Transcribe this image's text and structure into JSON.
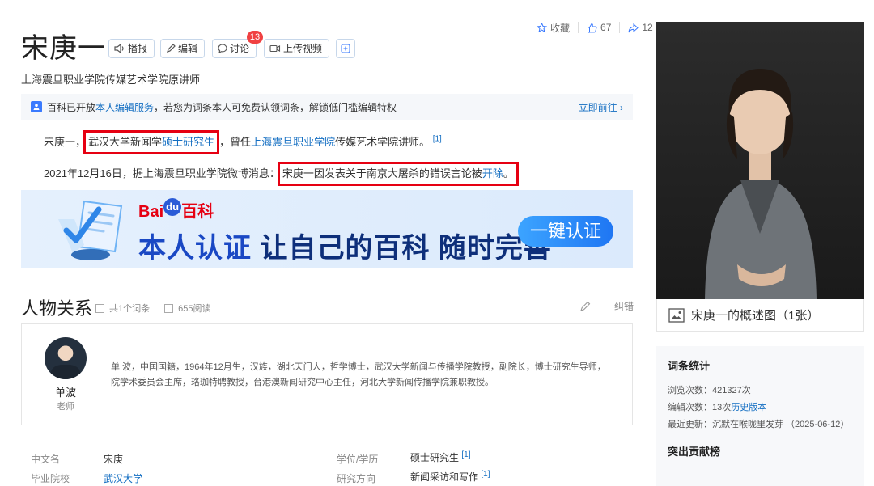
{
  "header": {
    "title": "宋庚一",
    "buttons": {
      "play": "播报",
      "edit": "编辑",
      "discuss": "讨论",
      "upload": "上传视频"
    },
    "discuss_badge": "13",
    "subtitle": "上海震旦职业学院传媒艺术学院原讲师",
    "favorite": "收藏",
    "likes": "67",
    "shares": "12"
  },
  "notice": {
    "text_a": "百科已开放",
    "link": "本人编辑服务",
    "text_b": "，若您为词条本人可免费认领词条，解锁低门槛编辑特权",
    "go": "立即前往"
  },
  "summary": {
    "p1_a": "宋庚一，",
    "p1_b": "武汉大学新闻学",
    "p1_link1": "硕士研究生",
    "p1_c": "，曾任",
    "p1_link2": "上海震旦职业学院",
    "p1_d": "传媒艺术学院讲师。",
    "p1_ref": "[1]",
    "p2_a": "2021年12月16日，据上海震旦职业学院微博消息：",
    "p2_b": "宋庚一因发表关于南京大屠杀的错误言论被",
    "p2_link": "开除",
    "p2_c": "。"
  },
  "banner": {
    "logo_a": "Bai",
    "logo_du": "du",
    "logo_b": "百科",
    "main_a": "本人认证 ",
    "main_b": "让自己的百科 随时完善",
    "button": "一键认证"
  },
  "relations": {
    "title": "人物关系",
    "entries": "共1个词条",
    "reads": "655阅读",
    "correct": "纠错",
    "person": {
      "name": "单波",
      "role": "老师",
      "desc": "单 波，中国国籍，1964年12月生，汉族，湖北天门人，哲学博士，武汉大学新闻与传播学院教授，副院长，博士研究生导师，院学术委员会主席，珞珈特聘教授，台港澳新闻研究中心主任，河北大学新闻传播学院兼职教授。"
    }
  },
  "basic_info": [
    {
      "key": "中文名",
      "value": "宋庚一",
      "link": false,
      "ref": ""
    },
    {
      "key": "学位/学历",
      "value": "硕士研究生",
      "link": false,
      "ref": "[1]"
    },
    {
      "key": "毕业院校",
      "value": "武汉大学",
      "link": true,
      "ref": ""
    },
    {
      "key": "研究方向",
      "value": "新闻采访和写作",
      "link": false,
      "ref": "[1]"
    }
  ],
  "sidebar": {
    "photo_caption": "宋庚一的概述图（1张）",
    "stats_title": "词条统计",
    "views": "浏览次数：421327次",
    "edits_a": "编辑次数：13次",
    "edits_link": "历史版本",
    "updated": "最近更新：沉默在喉咙里发芽 （2025-06-12）",
    "contrib_title": "突出贡献榜"
  },
  "colors": {
    "link": "#136ec2",
    "highlight_box": "#e60012",
    "accent": "#3a7afe"
  }
}
